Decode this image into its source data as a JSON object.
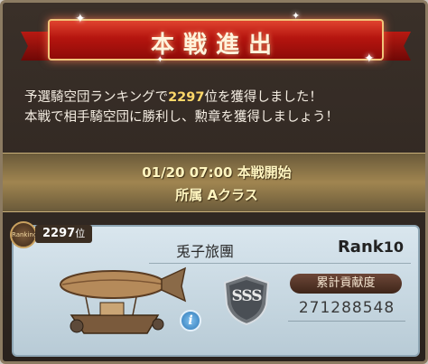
{
  "banner": {
    "title": "本戦進出"
  },
  "message": {
    "line1_pre": "予選騎空団ランキングで",
    "line1_rank": "2297",
    "line1_post": "位を獲得しました！",
    "line2": "本戦で相手騎空団に勝利し、勲章を獲得しましょう！"
  },
  "schedule": {
    "start": "01/20 07:00 本戦開始",
    "class": "所属 Aクラス"
  },
  "crew": {
    "badge_label": "Ranking",
    "rank_number": "2297",
    "rank_unit": "位",
    "name": "兎子旅團",
    "rank_label": "Rank",
    "rank_value": "10",
    "grade": "SSS",
    "honor_label": "累計貢献度",
    "honor_value": "271288548",
    "info_glyph": "i"
  },
  "colors": {
    "banner_red": "#b5150f",
    "highlight": "#ffd86a",
    "gold_band": "#a08550"
  }
}
